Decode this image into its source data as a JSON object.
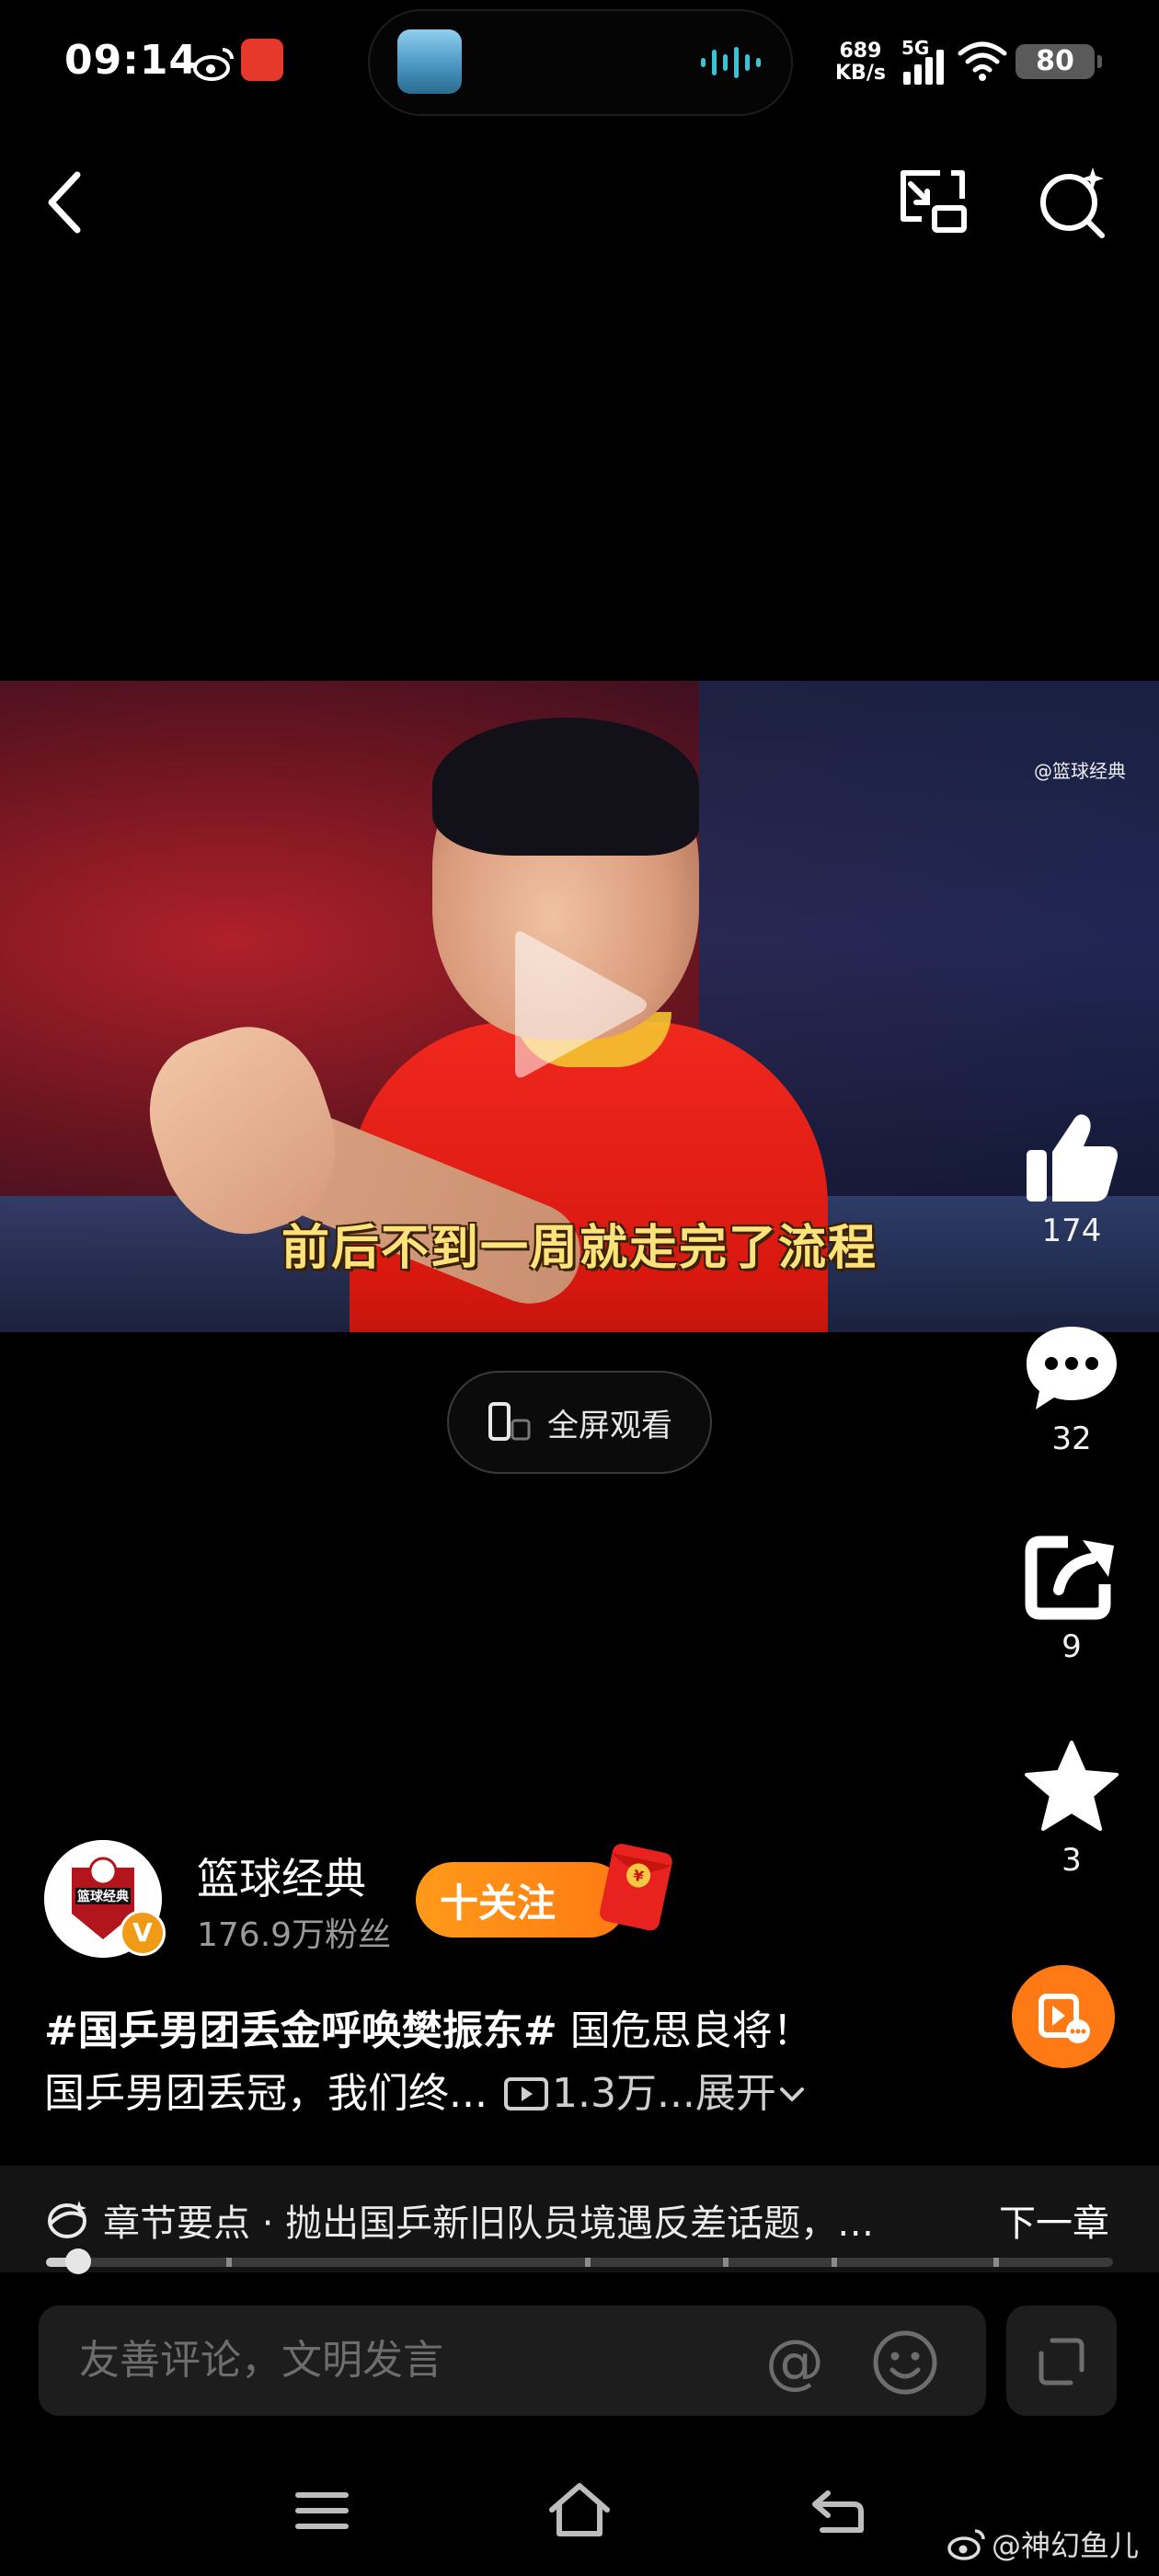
{
  "status_bar": {
    "time": "09:14",
    "net_speed_value": "689",
    "net_speed_unit": "KB/s",
    "signal_label": "5G",
    "battery": "80"
  },
  "video": {
    "watermark": "@篮球经典",
    "subtitle": "前后不到一周就走完了流程"
  },
  "fullscreen": {
    "label": "全屏观看"
  },
  "actions": {
    "like_count": "174",
    "comment_count": "32",
    "share_count": "9",
    "favorite_count": "3"
  },
  "author": {
    "name": "篮球经典",
    "fans": "176.9万粉丝",
    "follow_label": "十关注",
    "avatar_text": "篮球经典",
    "verified_mark": "V"
  },
  "caption": {
    "hashtag": "#国乒男团丢金呼唤樊振东#",
    "text_line1": " 国危思良将！",
    "text_line2": "国乒男团丢冠，我们终...",
    "views": "1.3万",
    "expand": " ...展开"
  },
  "chapter": {
    "text": "章节要点 · 抛出国乒新旧队员境遇反差话题，…",
    "next_label": "下一章",
    "progress": 0.03
  },
  "comment": {
    "placeholder": "友善评论，文明发言",
    "at_symbol": "@"
  },
  "credit": {
    "text": "@神幻鱼儿"
  },
  "colors": {
    "accent_orange": "#ff7a12",
    "subtitle_yellow": "#ffe27a",
    "background": "#000000"
  }
}
